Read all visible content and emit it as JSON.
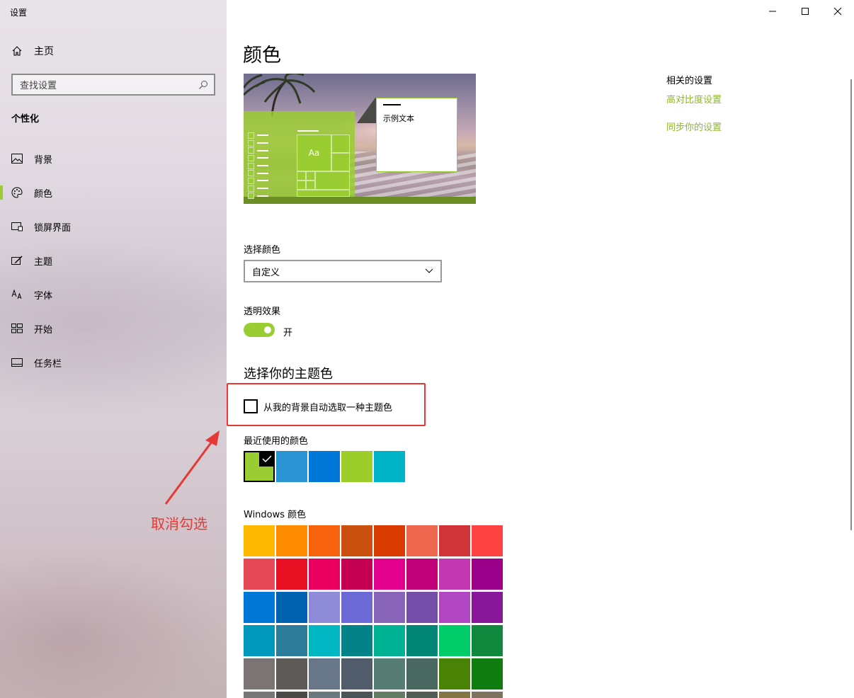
{
  "window": {
    "title": "设置",
    "controls": {
      "minimize": "minimize",
      "maximize": "maximize",
      "close": "close"
    }
  },
  "sidebar": {
    "home_label": "主页",
    "search_placeholder": "查找设置",
    "section_title": "个性化",
    "items": [
      {
        "label": "背景",
        "icon": "picture-icon",
        "active": false
      },
      {
        "label": "颜色",
        "icon": "palette-icon",
        "active": true
      },
      {
        "label": "锁屏界面",
        "icon": "lock-screen-icon",
        "active": false
      },
      {
        "label": "主题",
        "icon": "theme-brush-icon",
        "active": false
      },
      {
        "label": "字体",
        "icon": "font-icon",
        "active": false
      },
      {
        "label": "开始",
        "icon": "start-grid-icon",
        "active": false
      },
      {
        "label": "任务栏",
        "icon": "taskbar-icon",
        "active": false
      }
    ],
    "accent_color": "#9acd32"
  },
  "main": {
    "page_title": "颜色",
    "preview": {
      "tile_text": "Aa",
      "sample_text": "示例文本"
    },
    "choose_color": {
      "label": "选择颜色",
      "selected": "自定义"
    },
    "transparency": {
      "label": "透明效果",
      "state": "开",
      "on": true
    },
    "accent_heading": "选择你的主题色",
    "auto_pick": {
      "label": "从我的背景自动选取一种主题色",
      "checked": false
    },
    "recent_label": "最近使用的颜色",
    "recent_colors": [
      "#9acd32",
      "#2b95d4",
      "#0078d7",
      "#9ccd2a",
      "#00b4c8"
    ],
    "windows_colors_label": "Windows 颜色",
    "windows_colors": [
      [
        "#ffb900",
        "#ff8c00",
        "#f7630c",
        "#ca5010",
        "#da3b01",
        "#ef6950",
        "#d13438",
        "#ff4343"
      ],
      [
        "#e74856",
        "#e81123",
        "#ea005e",
        "#c30052",
        "#e3008c",
        "#bf0077",
        "#c239b3",
        "#9a0089"
      ],
      [
        "#0078d7",
        "#0063b1",
        "#8e8cd8",
        "#6b69d6",
        "#8764b8",
        "#744da9",
        "#b146c2",
        "#881798"
      ],
      [
        "#0099bc",
        "#2d7d9a",
        "#00b7c3",
        "#038387",
        "#00b294",
        "#018574",
        "#00cc6a",
        "#10893e"
      ],
      [
        "#7a7574",
        "#5d5a58",
        "#68768a",
        "#515c6b",
        "#567c73",
        "#486860",
        "#498205",
        "#107c10"
      ],
      [
        "#767676",
        "#4c4a48",
        "#69797e",
        "#4a5459",
        "#647c64",
        "#525e54",
        "#847545",
        "#7e735f"
      ]
    ]
  },
  "related": {
    "heading": "相关的设置",
    "links": [
      "高对比度设置",
      "同步你的设置"
    ]
  },
  "annotation": {
    "text": "取消勾选",
    "color": "#e53935"
  }
}
